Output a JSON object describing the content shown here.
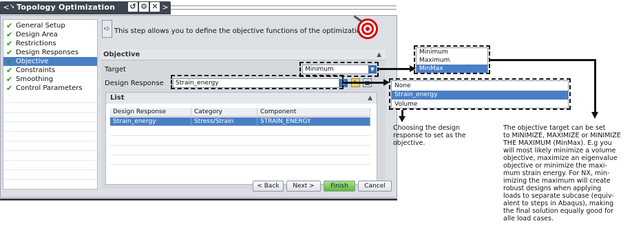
{
  "title_bar": {
    "title": "Topology Optimization",
    "nav_prev": "<",
    "nav_next": ">",
    "btn_reset": "↺",
    "btn_settings": "⚙",
    "btn_close": "✕"
  },
  "steps": [
    {
      "label": "General Setup",
      "done": true
    },
    {
      "label": "Design Area",
      "done": true
    },
    {
      "label": "Restrictions",
      "done": true
    },
    {
      "label": "Design Responses",
      "done": true
    },
    {
      "label": "Objective",
      "done": true,
      "selected": true
    },
    {
      "label": "Constraints",
      "done": true
    },
    {
      "label": "Smoothing",
      "done": true
    },
    {
      "label": "Control Parameters",
      "done": true
    }
  ],
  "info": {
    "text": "This step allows you to define the objective functions of the optimization"
  },
  "objective": {
    "section_title": "Objective",
    "target_label": "Target",
    "target_value": "Minimum",
    "design_response_label": "Design Response",
    "design_response_value": "Strain_energy"
  },
  "list": {
    "title": "List",
    "columns": [
      "Design Response",
      "Category",
      "Component"
    ],
    "rows": [
      [
        "Strain_energy",
        "Stress/Strain",
        "STRAIN_ENERGY"
      ]
    ]
  },
  "buttons": {
    "back": "< Back",
    "next": "Next >",
    "finish": "Finish",
    "cancel": "Cancel"
  },
  "target_popup": {
    "options": [
      "Minimum",
      "Maximum",
      "MinMax"
    ],
    "selected": "MinMax"
  },
  "response_popup": {
    "options": [
      "None",
      "Strain_energy",
      "Volume"
    ],
    "selected": "Strain_energy"
  },
  "annotations": {
    "design_response_note": [
      "Choosing the design",
      "response to set as the",
      "objective."
    ],
    "target_note": [
      "The objective target can be set",
      "to MINIMIZE, MAXIMIZE or MINIMIZE",
      "THE MAXIMUM (MinMax). E.g you",
      "will most likely minimize a volume",
      "objective, maximize an eigenvalue",
      "objective or minimize the maxi-",
      "mum strain energy. For NX, min-",
      "imizing the maximum will create",
      "robust designs when applying",
      "loads to separate subcase (equiv-",
      "alent to steps in Abaqus), making",
      "the final solution equally good for",
      "alle load cases."
    ]
  },
  "colors": {
    "selection": "#4a7fc5",
    "title_bar": "#3d4550",
    "finish_button": "#5cb83a"
  }
}
